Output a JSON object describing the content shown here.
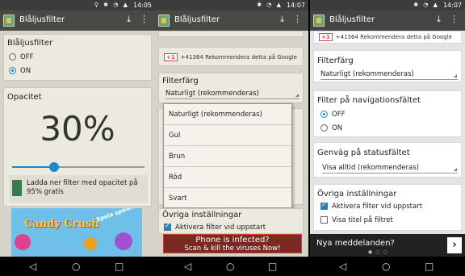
{
  "status_bars": [
    {
      "time": "14:05",
      "battery": "70%"
    },
    {
      "time": "14:07",
      "battery": "70%"
    },
    {
      "time": "14:07",
      "battery": "70%"
    }
  ],
  "app": {
    "title": "Blåljusfilter"
  },
  "screen1": {
    "filter_card": {
      "title": "Blåljusfilter",
      "off": "OFF",
      "on": "ON",
      "selected": "ON"
    },
    "opacity_card": {
      "title": "Opacitet",
      "value": "30%",
      "slider_value": 0.32,
      "hint": "Ladda ner filter med opacitet på 95% gratis"
    },
    "ad": {
      "title_a": "Candy",
      "title_b": "Crush",
      "banner": "Spela spelet!"
    }
  },
  "screen2": {
    "gplus": {
      "label": "+1",
      "text": "+41364 Rekommendera detta på Google"
    },
    "filter_color": {
      "title": "Filterfärg",
      "value": "Naturligt (rekommenderas)"
    },
    "dropdown_options": [
      "Naturligt (rekommenderas)",
      "Gul",
      "Brun",
      "Röd",
      "Svart"
    ],
    "other_settings": {
      "title": "Övriga inställningar",
      "autostart": "Aktivera filter vid uppstart"
    },
    "ad": {
      "line1": "Phone is infected?",
      "line2": "Scan & kill the viruses Now!"
    }
  },
  "screen3": {
    "gplus": {
      "label": "+1",
      "text": "+41364 Rekommendera detta på Google"
    },
    "filter_color": {
      "title": "Filterfärg",
      "value": "Naturligt (rekommenderas)"
    },
    "nav_filter": {
      "title": "Filter på navigationsfältet",
      "off": "OFF",
      "on": "ON",
      "selected": "OFF"
    },
    "shortcut": {
      "title": "Genväg på statusfältet",
      "value": "Visa alltid (rekommenderas)"
    },
    "other_settings": {
      "title": "Övriga inställningar",
      "autostart": "Aktivera filter vid uppstart",
      "show_title": "Visa titel på filtret"
    },
    "news": {
      "text": "Nya meddelanden?"
    }
  },
  "icons": [
    "download-icon",
    "overflow-menu-icon",
    "back-icon",
    "home-icon",
    "recents-icon"
  ],
  "colors": {
    "accent": "#1e88c8",
    "appbar": "#4a4a44",
    "slider": "#1e88c8"
  }
}
